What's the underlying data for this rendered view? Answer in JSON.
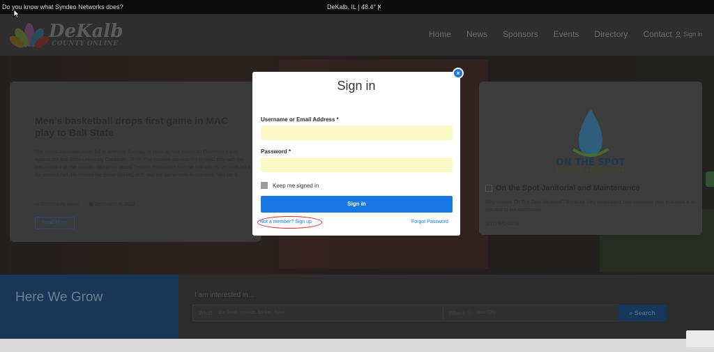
{
  "topbar": {
    "ticker": "Do you know what Syndeo Networks does?",
    "weather": "DeKalb, IL | 48.4° |",
    "close": "x"
  },
  "header": {
    "brand": "DeKalb",
    "brand_sub": "COUNTY ONLINE",
    "nav": [
      "Home",
      "News",
      "Sponsors",
      "Events",
      "Directory",
      "Contact"
    ],
    "signin": "Sign in"
  },
  "article": {
    "title": "Men’s basketball drops first game in MAC play to Ball State",
    "excerpt": "The men’s basketball team fell in overtime Tuesday to open up Mid-American Conference play against the Ball State University Cardinals, 78-70. The Huskies are now 0-1 in MAC play with the loss and 0-4 on the season. NIU junior guard Trendon Hankerson had the ball with 10 seconds left in the second half. He missed the game winning shot, and the game went to overtime. “We (as a ...",
    "category": "Community News",
    "date": "December 9, 2020",
    "read_more": "Read More"
  },
  "sponsor": {
    "name": "On the Spot Janitorial and Maintenance",
    "logo_line1": "ON THE SPOT",
    "logo_line2": "JANITORIAL & MAINTENANCE",
    "logo_line3": "BUILDING SERVICES",
    "desc": "Why choose On The Spot Janitorial? Because they understand how important your business is to you and to our community.",
    "phone": "(815) 970-3019"
  },
  "grow": {
    "heading": "Here We Grow",
    "interest": "I am interested in...",
    "what_label": "What",
    "what_placeholder": "Ex: food, service, barber, hotel",
    "where_label": "Where",
    "where_placeholder": "Your City...",
    "search_button": "Search"
  },
  "modal": {
    "title": "Sign in",
    "username_label": "Username or Email Address *",
    "password_label": "Password *",
    "remember_label": "Keep me signed in",
    "submit": "Sign in",
    "signup": "Not a member? Sign up",
    "forgot": "Forgot Password",
    "close": "×"
  },
  "colors": {
    "accent": "#1877e5",
    "field_bg": "#fbf9c8",
    "annotation": "#d62b2b"
  }
}
